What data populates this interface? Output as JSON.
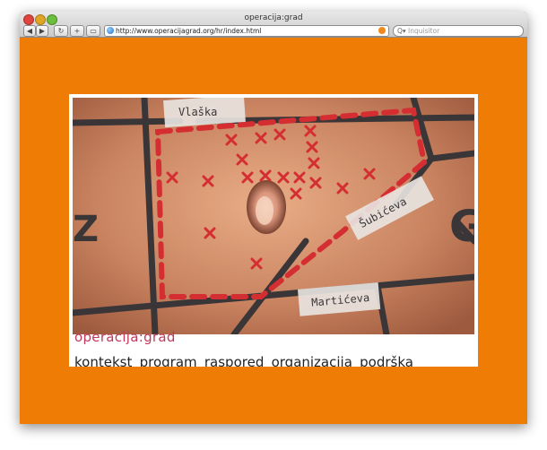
{
  "window": {
    "title": "operacija:grad"
  },
  "toolbar": {
    "back_label": "◀",
    "forward_label": "▶",
    "reload_label": "↻",
    "add_label": "+",
    "snapback_label": "▭"
  },
  "address_bar": {
    "url": "http://www.operacijagrad.org/hr/index.html"
  },
  "search": {
    "glyph": "Q▾",
    "placeholder": "Inquisitor"
  },
  "photo": {
    "street_labels": [
      "Vlaška",
      "Šubićeva",
      "Martićeva"
    ],
    "mark_color": "#d42e33"
  },
  "site": {
    "title": "operacija:grad",
    "nav": [
      "kontekst",
      "program",
      "raspored",
      "organizacija",
      "podrška"
    ]
  }
}
